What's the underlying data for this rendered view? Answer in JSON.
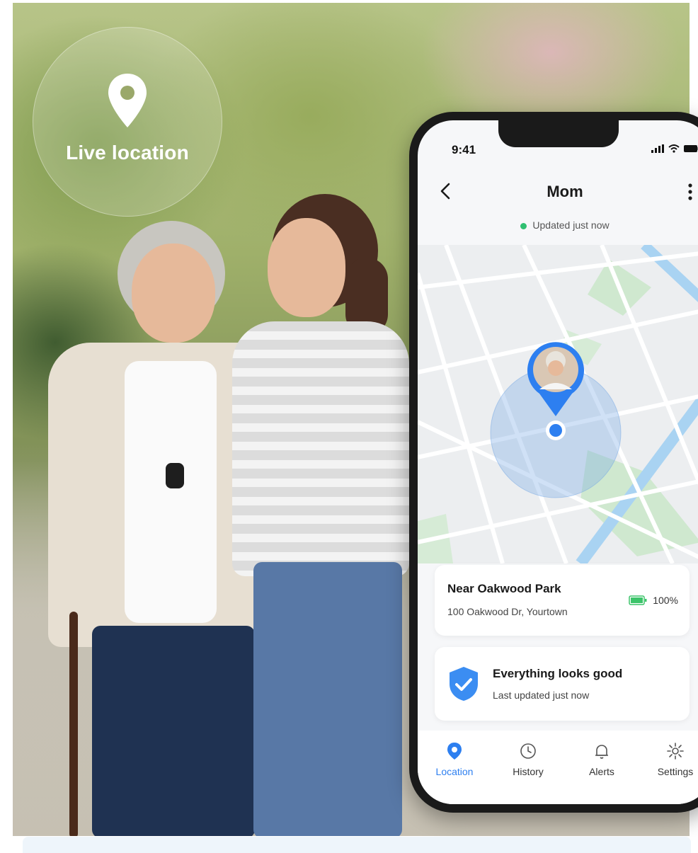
{
  "badge": {
    "label": "Live location",
    "icon": "map-pin-icon"
  },
  "phone": {
    "status_time": "9:41",
    "title": "Mom",
    "updated_text": "Updated just now",
    "location_card": {
      "place_name": "Near Oakwood Park",
      "address": "100 Oakwood Dr, Yourtown",
      "battery": "100%"
    },
    "status_card": {
      "title": "Everything looks good",
      "subtitle": "Last updated just now"
    },
    "tabs": [
      {
        "label": "Location",
        "icon": "location-pin-icon"
      },
      {
        "label": "History",
        "icon": "clock-icon"
      },
      {
        "label": "Alerts",
        "icon": "bell-icon"
      },
      {
        "label": "Settings",
        "icon": "gear-icon"
      }
    ]
  },
  "colors": {
    "accent": "#2d7ff0",
    "online_dot": "#2fbf71",
    "battery": "#3cc46a"
  }
}
